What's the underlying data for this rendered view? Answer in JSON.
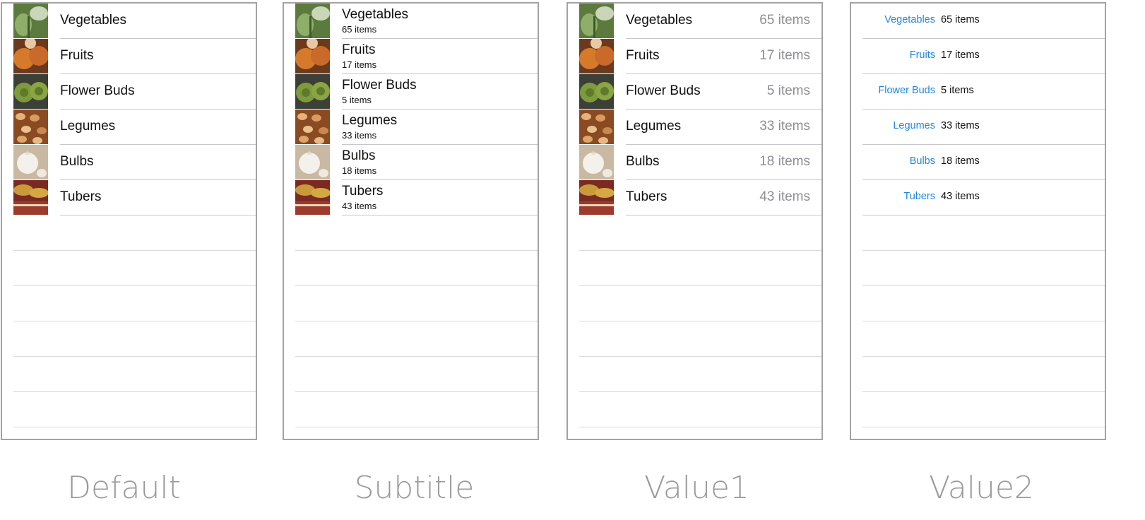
{
  "categories": [
    {
      "name": "Vegetables",
      "count": "65 items",
      "icon": "vegetables-thumbnail"
    },
    {
      "name": "Fruits",
      "count": "17 items",
      "icon": "fruits-thumbnail"
    },
    {
      "name": "Flower Buds",
      "count": "5 items",
      "icon": "flower-buds-thumbnail"
    },
    {
      "name": "Legumes",
      "count": "33 items",
      "icon": "legumes-thumbnail"
    },
    {
      "name": "Bulbs",
      "count": "18 items",
      "icon": "bulbs-thumbnail"
    },
    {
      "name": "Tubers",
      "count": "43 items",
      "icon": "tubers-thumbnail"
    }
  ],
  "styles": {
    "default": "Default",
    "subtitle": "Subtitle",
    "value1": "Value1",
    "value2": "Value2"
  },
  "colors": {
    "accent": "#1f86e0",
    "detail_gray": "#8e8e93",
    "separator": "#c8c7cc",
    "caption": "#9a9a9a"
  }
}
